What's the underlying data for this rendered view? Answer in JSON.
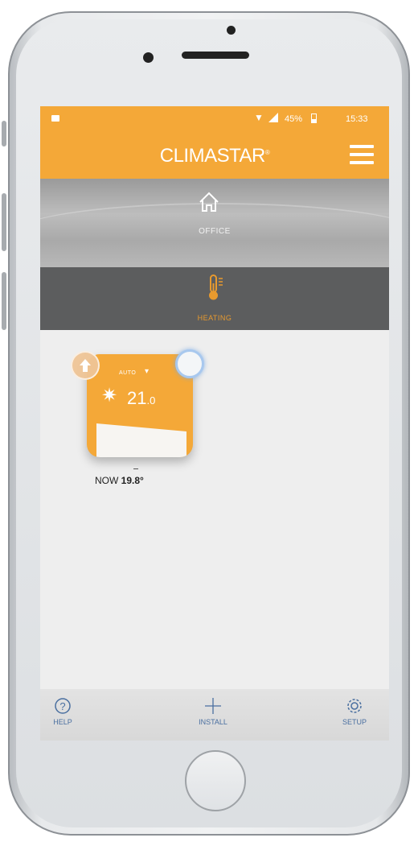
{
  "status_bar": {
    "battery_percent": "45%",
    "time": "15:33"
  },
  "app_bar": {
    "brand": "CLIMASTAR",
    "brand_mark": "®",
    "menu_icon": "hamburger-menu-icon"
  },
  "location": {
    "name": "OFFICE",
    "icon": "house-icon"
  },
  "mode_section": {
    "label": "HEATING",
    "icon": "thermometer-icon"
  },
  "device_card": {
    "mode": "AUTO",
    "setpoint_int": "21",
    "setpoint_dec": ".0",
    "now_label": "NOW",
    "now_value": "19.8°",
    "colors": {
      "card": "#f4a838",
      "toggle_ring": "#a8c8ee"
    }
  },
  "bottom_nav": {
    "help": "HELP",
    "install": "INSTALL",
    "setup": "SETUP"
  }
}
